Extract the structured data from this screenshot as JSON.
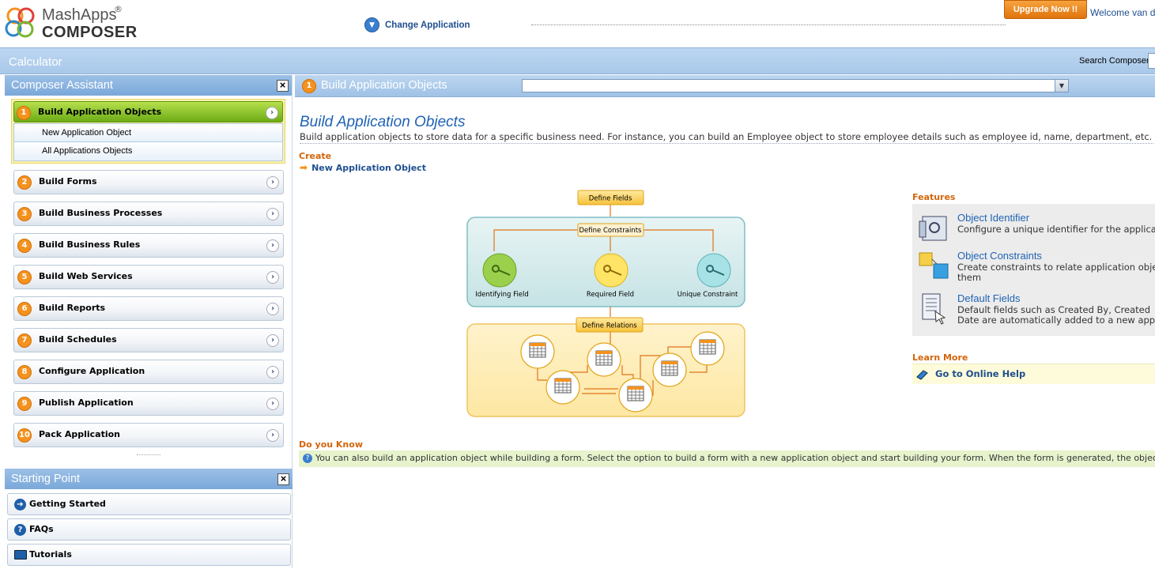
{
  "header": {
    "logo_line1": "MashApps",
    "logo_reg": "®",
    "logo_line2": "COMPOSER",
    "change_app": "Change Application",
    "upgrade": "Upgrade Now !!",
    "welcome": "Welcome van d"
  },
  "bar": {
    "title": "Calculator",
    "search_label": "Search Composer"
  },
  "assistant": {
    "title": "Composer Assistant",
    "active": {
      "num": "1",
      "label": "Build Application Objects",
      "subitems": [
        "New Application Object",
        "All Applications Objects"
      ]
    },
    "items": [
      {
        "num": "2",
        "label": "Build Forms"
      },
      {
        "num": "3",
        "label": "Build Business Processes"
      },
      {
        "num": "4",
        "label": "Build Business Rules"
      },
      {
        "num": "5",
        "label": "Build Web Services"
      },
      {
        "num": "6",
        "label": "Build Reports"
      },
      {
        "num": "7",
        "label": "Build Schedules"
      },
      {
        "num": "8",
        "label": "Configure Application"
      },
      {
        "num": "9",
        "label": "Publish Application"
      },
      {
        "num": "10",
        "label": "Pack Application"
      }
    ]
  },
  "starting_point": {
    "title": "Starting Point",
    "items": [
      {
        "label": "Getting Started",
        "icon": "arrow-circle-icon"
      },
      {
        "label": "FAQs",
        "icon": "help-icon"
      },
      {
        "label": "Tutorials",
        "icon": "monitor-icon"
      }
    ]
  },
  "main": {
    "num": "1",
    "header": "Build Application Objects",
    "title": "Build Application Objects",
    "description": "Build application objects to store data for a specific business need. For instance, you can build an Employee object to store employee details such as employee id, name, department, etc.",
    "create_label": "Create",
    "create_link": "New Application Object",
    "diagram": {
      "define_fields": "Define Fields",
      "define_constraints": "Define Constraints",
      "identifying": "Identifying Field",
      "required": "Required Field",
      "unique": "Unique Constraint",
      "define_relations": "Define Relations"
    },
    "features_label": "Features",
    "features": [
      {
        "title": "Object Identifier",
        "desc1": "Configure a unique identifier for the applica",
        "desc2": ""
      },
      {
        "title": "Object Constraints",
        "desc1": "Create constraints to relate application obje",
        "desc2": "them"
      },
      {
        "title": "Default Fields",
        "desc1": "Default fields such as Created By, Created",
        "desc2": "Date are automatically added to a new appl"
      }
    ],
    "learn_more_label": "Learn More",
    "help_link": "Go to Online Help",
    "dyk_label": "Do you Know",
    "dyk_text": "You can also build an application object while building a form. Select the option to build a form with a new application object and start building your form. When the form is generated, the object is built for you automatically"
  },
  "colors": {
    "accent": "#f5921e",
    "link": "#1f4f8f",
    "active_green": "#8cc424",
    "panel_blue": "#a9c9ea"
  }
}
